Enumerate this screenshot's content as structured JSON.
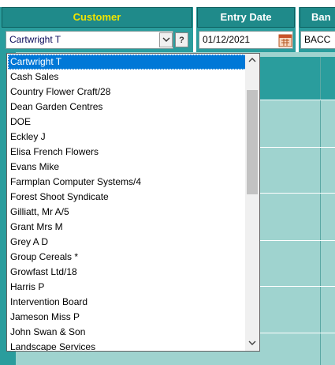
{
  "header": {
    "customer_label": "Customer",
    "entry_date_label": "Entry Date",
    "bank_label": "Ban"
  },
  "form": {
    "customer_value": "Cartwright T",
    "help_button": "?",
    "entry_date_value": "01/12/2021",
    "bank_value": "BACC"
  },
  "dropdown": {
    "items": [
      "Cartwright T",
      "Cash Sales",
      "Country Flower Craft/28",
      "Dean Garden Centres",
      "DOE",
      "Eckley J",
      "Elisa French Flowers",
      "Evans Mike",
      "Farmplan Computer Systems/4",
      "Forest Shoot Syndicate",
      "Gilliatt, Mr A/5",
      "Grant Mrs M",
      "Grey A D",
      "Group Cereals *",
      "Growfast Ltd/18",
      "Harris P",
      "Intervention Board",
      "Jameson Miss P",
      "John Swan & Son",
      "Landscape Services"
    ],
    "selected_index": 0
  },
  "colors": {
    "header_teal": "#1f8a8a",
    "customer_label": "#f0e400",
    "selection_blue": "#0078d7",
    "grid_teal": "#9fd3cf"
  }
}
